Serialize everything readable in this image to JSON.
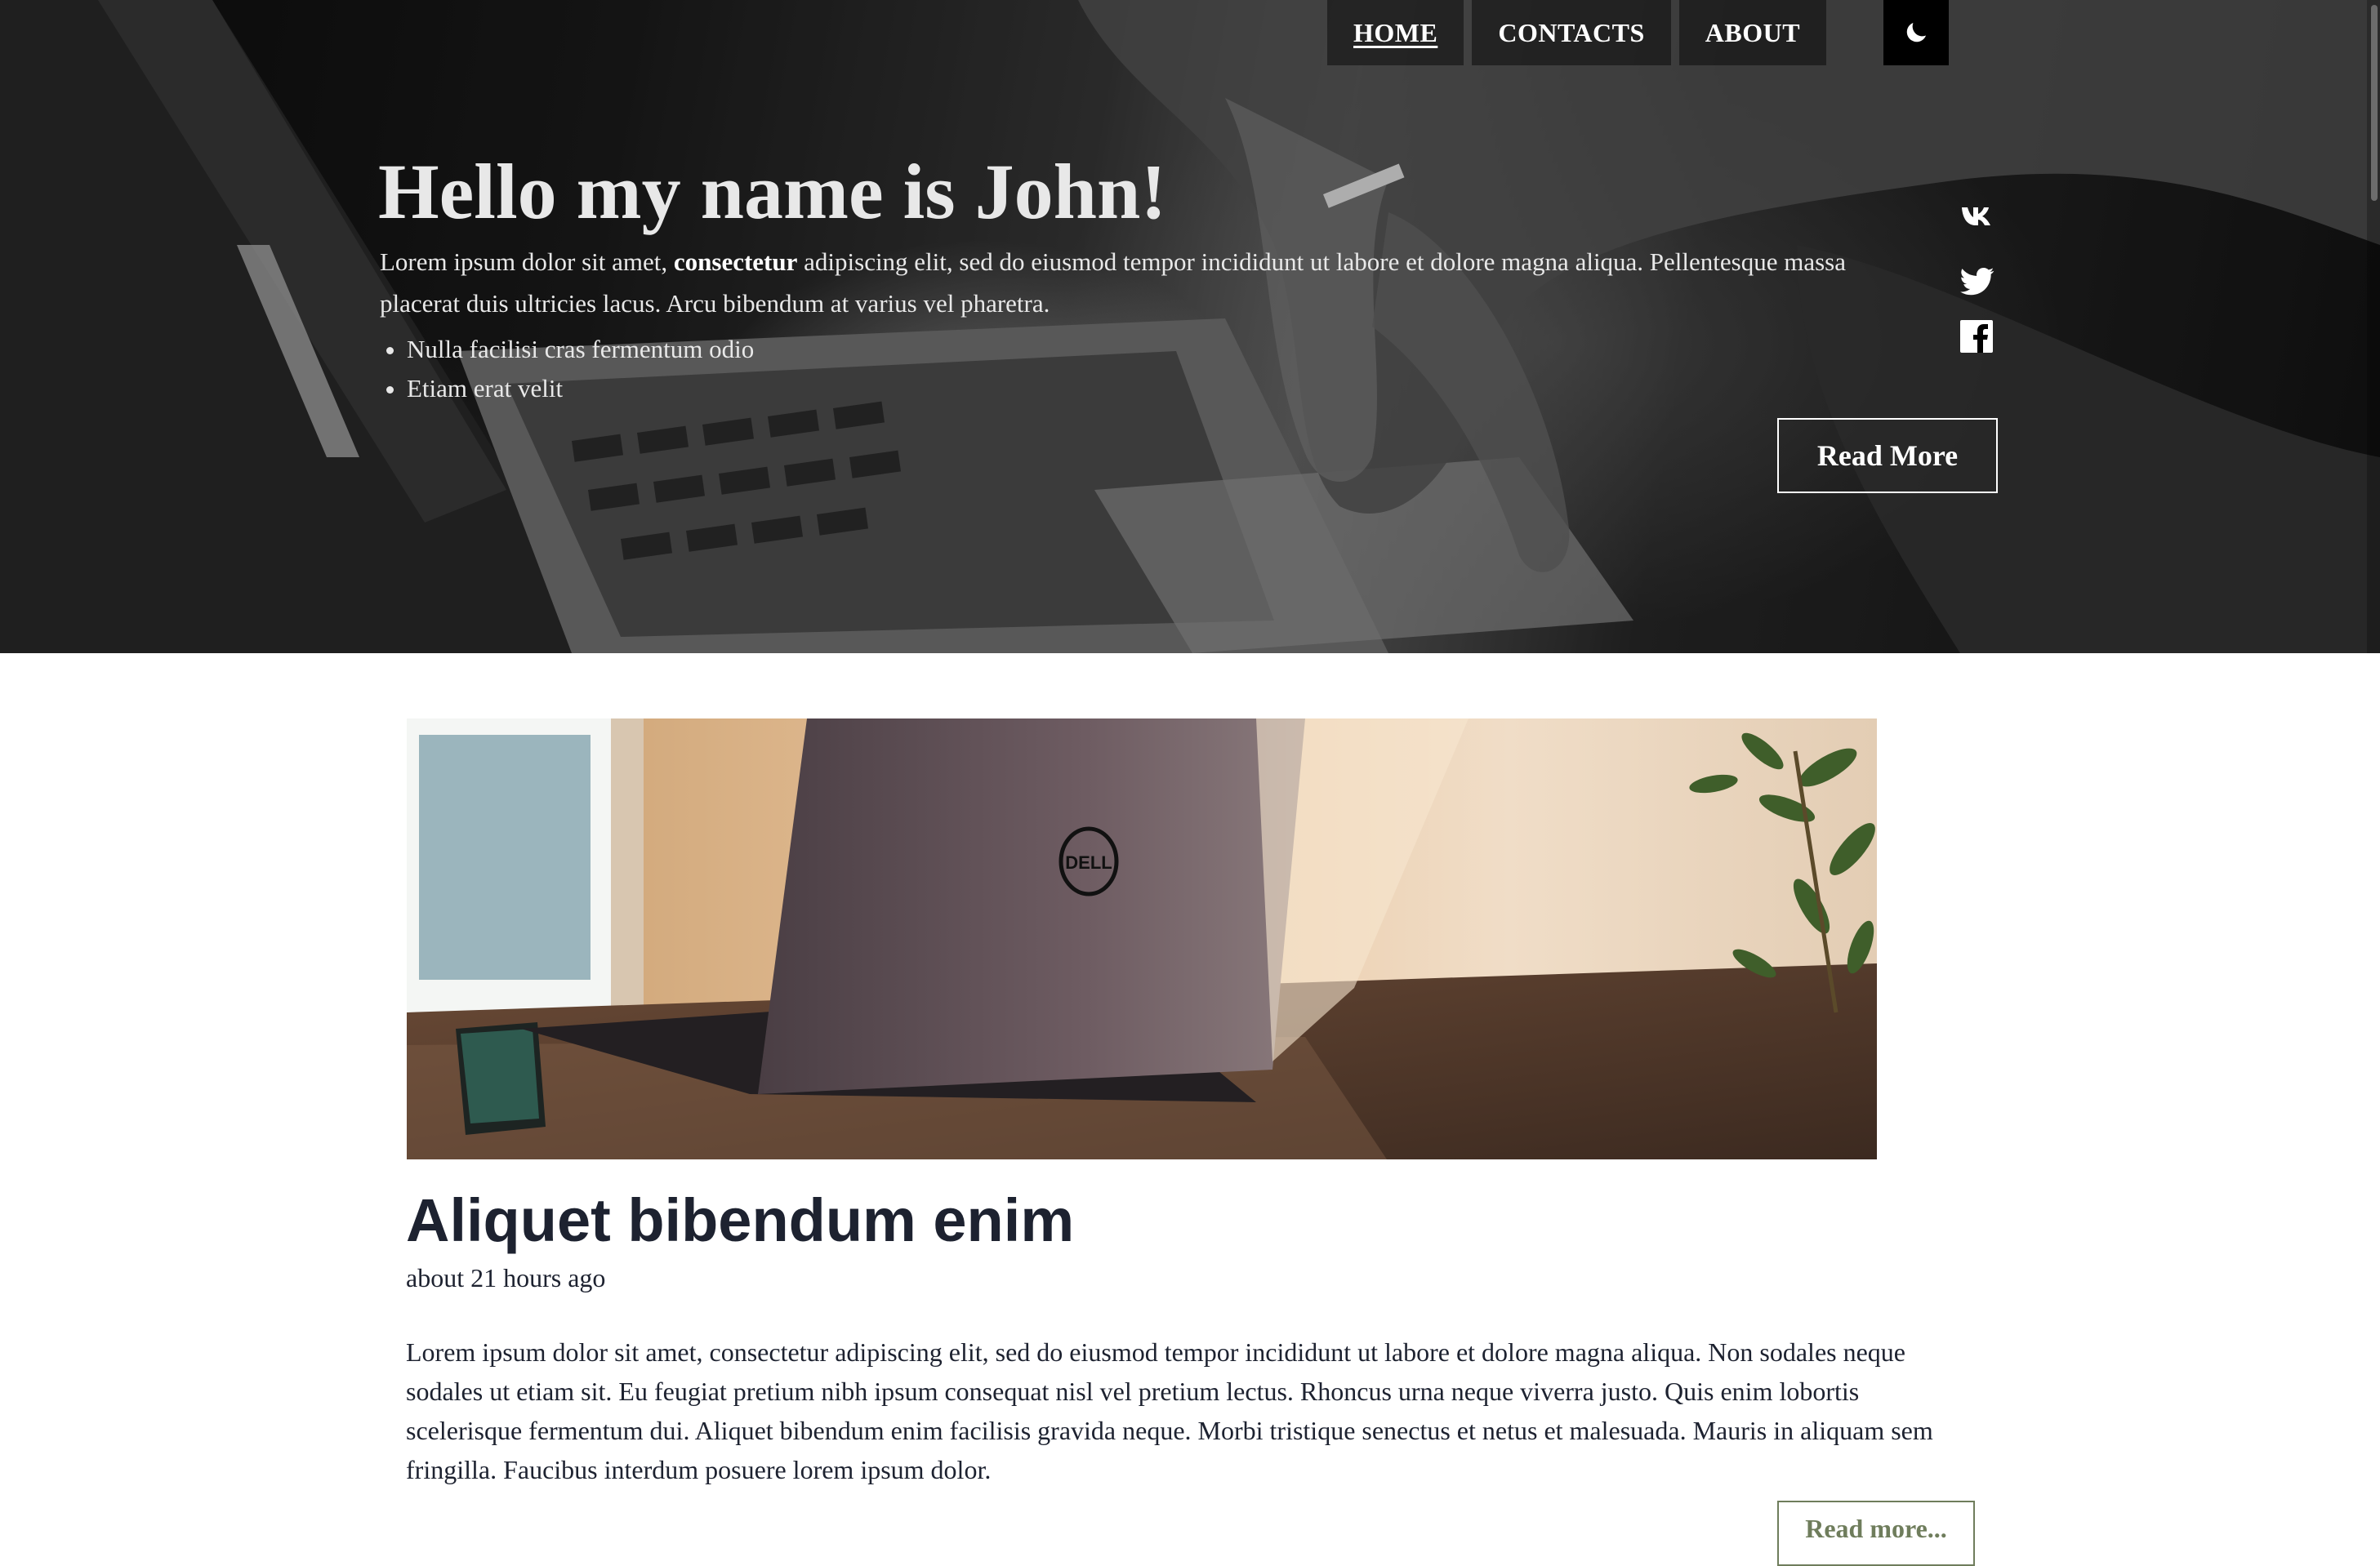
{
  "nav": {
    "items": [
      {
        "label": "HOME",
        "active": true
      },
      {
        "label": "CONTACTS",
        "active": false
      },
      {
        "label": "ABOUT",
        "active": false
      }
    ],
    "theme_toggle_icon": "moon-icon"
  },
  "hero": {
    "title": "Hello my name is John!",
    "text_before_bold": "Lorem ipsum dolor sit amet, ",
    "text_bold": "consectetur",
    "text_after_bold": " adipiscing elit, sed do eiusmod tempor incididunt ut labore et dolore magna aliqua. Pellentesque massa placerat duis ultricies lacus. Arcu bibendum at varius vel pharetra.",
    "list": [
      "Nulla facilisi cras fermentum odio",
      "Etiam erat velit"
    ],
    "social_icons": [
      "vk-icon",
      "twitter-icon",
      "facebook-icon"
    ],
    "read_more_label": "Read More"
  },
  "post": {
    "title": "Aliquet bibendum enim",
    "time": "about 21 hours ago",
    "body": "Lorem ipsum dolor sit amet, consectetur adipiscing elit, sed do eiusmod tempor incididunt ut labore et dolore magna aliqua. Non sodales neque sodales ut etiam sit. Eu feugiat pretium nibh ipsum consequat nisl vel pretium lectus. Rhoncus urna neque viverra justo. Quis enim lobortis scelerisque fermentum dui. Aliquet bibendum enim facilisis gravida neque. Morbi tristique senectus et netus et malesuada. Mauris in aliquam sem fringilla. Faucibus interdum posuere lorem ipsum dolor.",
    "read_more_label": "Read more...",
    "image_logo_text": "DELL"
  },
  "colors": {
    "post_text": "#1d2230",
    "post_button": "#6f7d5c"
  }
}
